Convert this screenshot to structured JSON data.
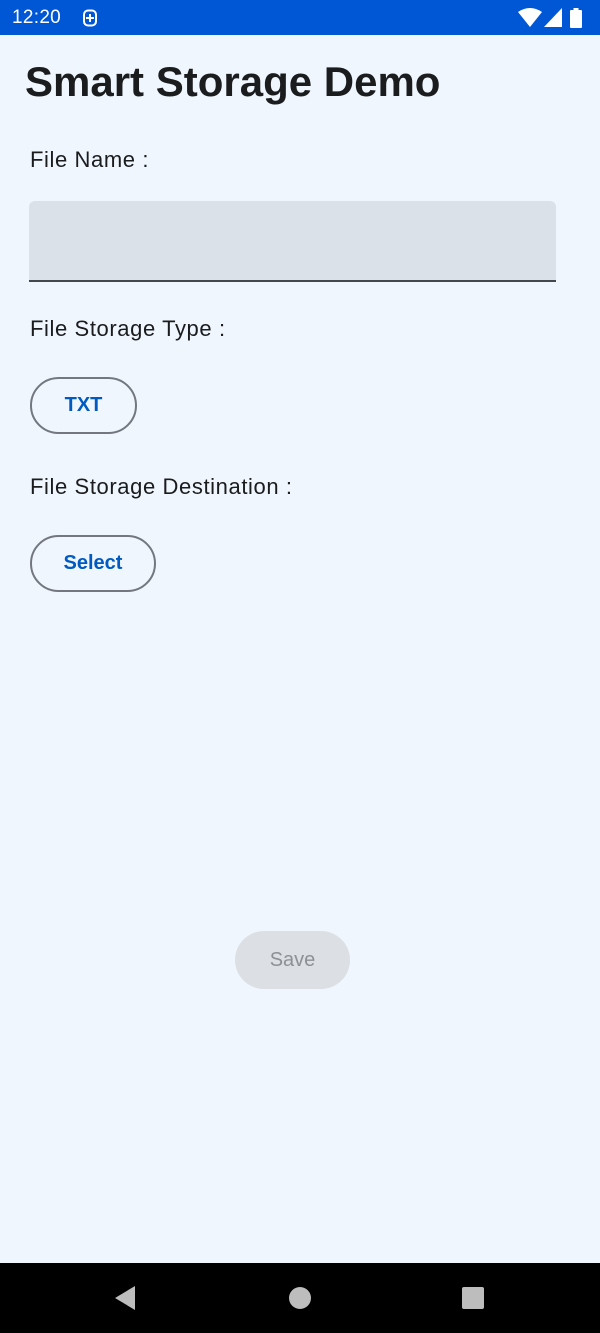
{
  "status_bar": {
    "time": "12:20",
    "app_icon": "storage-notification-icon",
    "wifi_icon": "wifi-icon",
    "signal_icon": "cell-signal-icon",
    "battery_icon": "battery-icon",
    "background_color": "#0057d6"
  },
  "app": {
    "title": "Smart Storage Demo"
  },
  "form": {
    "file_name_label": "File Name :",
    "file_name_value": "",
    "storage_type_label": "File Storage Type :",
    "storage_type_button": "TXT",
    "destination_label": "File Storage Destination :",
    "destination_button": "Select",
    "save_button": "Save",
    "save_enabled": false
  },
  "nav_bar": {
    "back_icon": "back-triangle-icon",
    "home_icon": "home-circle-icon",
    "recents_icon": "recents-square-icon"
  },
  "colors": {
    "background": "#eff6fd",
    "accent": "#005ac1",
    "input_fill": "#dbe1e8",
    "disabled_fill": "#dcdfe4"
  }
}
